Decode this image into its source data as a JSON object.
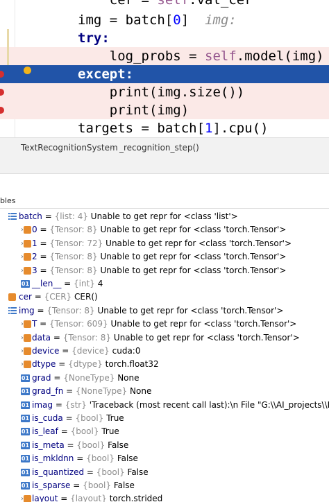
{
  "editor": {
    "lines": [
      {
        "indent": "    ",
        "code": "cer = self.val_cer"
      },
      {
        "indent": "",
        "code": "img = batch[0]",
        "hint": "img:"
      },
      {
        "indent": "",
        "code": "try:"
      },
      {
        "indent": "    ",
        "code": "log_probs = self.model(img)"
      },
      {
        "indent": "",
        "code": "except:"
      },
      {
        "indent": "    ",
        "code": "print(img.size())"
      },
      {
        "indent": "    ",
        "code": "print(img)"
      },
      {
        "indent": "",
        "code": "targets = batch[1].cpu()"
      }
    ]
  },
  "breadcrumb": {
    "class_name": "TextRecognitionSystem",
    "separator": "›",
    "method_name": "_recognition_step()"
  },
  "panel": {
    "title": "bles"
  },
  "variables": [
    {
      "depth": 0,
      "arrow": "",
      "icon": "list",
      "name": "batch",
      "type": "{list: 4}",
      "value": "Unable to get repr for <class 'list'>"
    },
    {
      "depth": 1,
      "arrow": "›",
      "icon": "obj",
      "name": "0",
      "type": "{Tensor: 8}",
      "value": "Unable to get repr for <class 'torch.Tensor'>"
    },
    {
      "depth": 1,
      "arrow": "›",
      "icon": "obj",
      "name": "1",
      "type": "{Tensor: 72}",
      "value": "Unable to get repr for <class 'torch.Tensor'>"
    },
    {
      "depth": 1,
      "arrow": "›",
      "icon": "obj",
      "name": "2",
      "type": "{Tensor: 8}",
      "value": "Unable to get repr for <class 'torch.Tensor'>"
    },
    {
      "depth": 1,
      "arrow": "›",
      "icon": "obj",
      "name": "3",
      "type": "{Tensor: 8}",
      "value": "Unable to get repr for <class 'torch.Tensor'>"
    },
    {
      "depth": 1,
      "arrow": "",
      "icon": "num",
      "name": "__len__",
      "type": "{int}",
      "value": "4"
    },
    {
      "depth": 0,
      "arrow": "",
      "icon": "obj",
      "name": "cer",
      "type": "{CER}",
      "value": "CER()"
    },
    {
      "depth": 0,
      "arrow": "",
      "icon": "list",
      "name": "img",
      "type": "{Tensor: 8}",
      "value": "Unable to get repr for <class 'torch.Tensor'>"
    },
    {
      "depth": 1,
      "arrow": "›",
      "icon": "obj",
      "name": "T",
      "type": "{Tensor: 609}",
      "value": "Unable to get repr for <class 'torch.Tensor'>"
    },
    {
      "depth": 1,
      "arrow": "›",
      "icon": "obj",
      "name": "data",
      "type": "{Tensor: 8}",
      "value": "Unable to get repr for <class 'torch.Tensor'>"
    },
    {
      "depth": 1,
      "arrow": "›",
      "icon": "obj",
      "name": "device",
      "type": "{device}",
      "value": "cuda:0"
    },
    {
      "depth": 1,
      "arrow": "›",
      "icon": "obj",
      "name": "dtype",
      "type": "{dtype}",
      "value": "torch.float32"
    },
    {
      "depth": 1,
      "arrow": "",
      "icon": "num",
      "name": "grad",
      "type": "{NoneType}",
      "value": "None"
    },
    {
      "depth": 1,
      "arrow": "",
      "icon": "num",
      "name": "grad_fn",
      "type": "{NoneType}",
      "value": "None"
    },
    {
      "depth": 1,
      "arrow": "",
      "icon": "str",
      "name": "imag",
      "type": "{str}",
      "value": "'Traceback (most recent call last):\\n  File \"G:\\\\AI_projects\\\\DL_Projects\\\\"
    },
    {
      "depth": 1,
      "arrow": "",
      "icon": "num",
      "name": "is_cuda",
      "type": "{bool}",
      "value": "True"
    },
    {
      "depth": 1,
      "arrow": "",
      "icon": "num",
      "name": "is_leaf",
      "type": "{bool}",
      "value": "True"
    },
    {
      "depth": 1,
      "arrow": "",
      "icon": "num",
      "name": "is_meta",
      "type": "{bool}",
      "value": "False"
    },
    {
      "depth": 1,
      "arrow": "",
      "icon": "num",
      "name": "is_mkldnn",
      "type": "{bool}",
      "value": "False"
    },
    {
      "depth": 1,
      "arrow": "",
      "icon": "num",
      "name": "is_quantized",
      "type": "{bool}",
      "value": "False"
    },
    {
      "depth": 1,
      "arrow": "",
      "icon": "num",
      "name": "is_sparse",
      "type": "{bool}",
      "value": "False"
    },
    {
      "depth": 1,
      "arrow": "›",
      "icon": "obj",
      "name": "layout",
      "type": "{layout}",
      "value": "torch.strided"
    }
  ],
  "icons": {
    "list": "list-icon",
    "obj": "object-icon",
    "num": "field-01-icon",
    "str": "field-01-icon",
    "num_glyph": "01",
    "breakpoint": "breakpoint-icon",
    "bulb": "intention-bulb-icon"
  }
}
